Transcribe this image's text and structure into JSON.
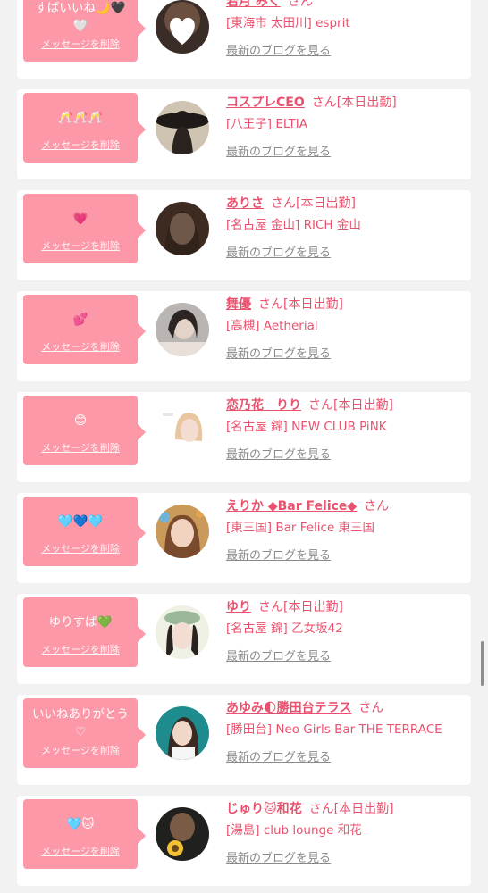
{
  "items": [
    {
      "message": "すばいいね🌙🖤🤍",
      "delete_label": "メッセージを削除",
      "name": "若月 みく",
      "suffix": "さん",
      "status": "",
      "shop": "[東海市 太田川] esprit",
      "blog_label": "最新のブログを見る",
      "avatar_icon": "white-heart-sticker"
    },
    {
      "message": "🥂🥂🥂",
      "delete_label": "メッセージを削除",
      "name": "コスプレCEO",
      "suffix": "さん",
      "status": "[本日出勤]",
      "shop": "[八王子] ELTIA",
      "blog_label": "最新のブログを見る",
      "avatar_icon": "hat-silhouette"
    },
    {
      "message": "💗",
      "delete_label": "メッセージを削除",
      "name": "ありさ",
      "suffix": "さん",
      "status": "[本日出勤]",
      "shop": "[名古屋 金山] RICH 金山",
      "blog_label": "最新のブログを見る",
      "avatar_icon": "portrait-dark"
    },
    {
      "message": "💕",
      "delete_label": "メッセージを削除",
      "name": "舞優",
      "suffix": "さん",
      "status": "[本日出勤]",
      "shop": "[高槻] Aetherial",
      "blog_label": "最新のブログを見る",
      "avatar_icon": "portrait-mono"
    },
    {
      "message": "😊",
      "delete_label": "メッセージを削除",
      "name": "恋乃花　りり",
      "suffix": "さん",
      "status": "[本日出勤]",
      "shop": "[名古屋 錦] NEW CLUB PiNK",
      "blog_label": "最新のブログを見る",
      "avatar_icon": "portrait-blonde"
    },
    {
      "message": "🩵💙🩵",
      "delete_label": "メッセージを削除",
      "name": "えりか ◆Bar Felice◆",
      "suffix": "さん",
      "status": "",
      "shop": "[東三国] Bar Felice 東三国",
      "blog_label": "最新のブログを見る",
      "avatar_icon": "portrait-warm"
    },
    {
      "message": "ゆりすば💚",
      "delete_label": "メッセージを削除",
      "name": "ゆり",
      "suffix": "さん",
      "status": "[本日出勤]",
      "shop": "[名古屋 錦] 乙女坂42",
      "blog_label": "最新のブログを見る",
      "avatar_icon": "portrait-beret"
    },
    {
      "message": "いいねありがとう♡",
      "delete_label": "メッセージを削除",
      "name": "あゆみ🌓勝田台テラス",
      "suffix": "さん",
      "status": "",
      "shop": "[勝田台] Neo Girls Bar THE TERRACE",
      "blog_label": "最新のブログを見る",
      "avatar_icon": "portrait-teal"
    },
    {
      "message": "🩵🐱",
      "delete_label": "メッセージを削除",
      "name": "じゅり🐱和花",
      "suffix": "さん",
      "status": "[本日出勤]",
      "shop": "[湯島] club lounge 和花",
      "blog_label": "最新のブログを見る",
      "avatar_icon": "portrait-sunflower"
    }
  ],
  "colors": {
    "accent": "#e9526e",
    "bubble": "#fc98a7",
    "background": "#f2f2f2"
  }
}
